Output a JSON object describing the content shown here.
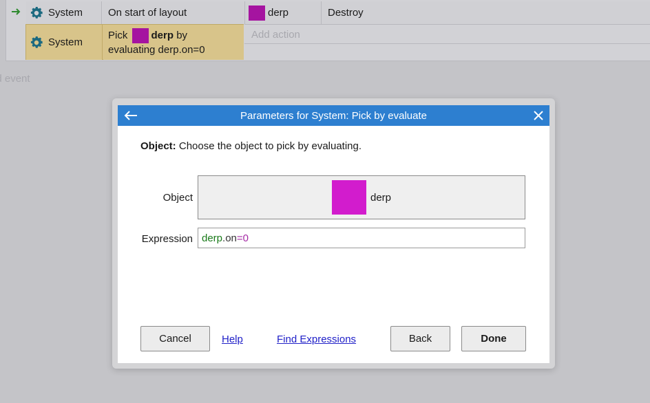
{
  "event_sheet": {
    "event1": {
      "condition_object": "System",
      "condition_text": "On start of layout",
      "action_object": "derp",
      "action_text": "Destroy"
    },
    "event1_sub": {
      "condition_object": "System",
      "pick_prefix": "Pick",
      "pick_object": "derp",
      "pick_suffix": "by",
      "pick_line2": "evaluating derp.on=0"
    },
    "add_action_label": "Add action",
    "add_event_label": "dd event"
  },
  "dialog": {
    "title": "Parameters for System: Pick by evaluate",
    "description_bold": "Object:",
    "description_text": "Choose the object to pick by evaluating.",
    "object_label": "Object",
    "object_value": "derp",
    "expression_label": "Expression",
    "expression": {
      "obj": "derp",
      "dot_prop": ".on",
      "op": "=",
      "num": "0"
    },
    "buttons": {
      "cancel": "Cancel",
      "help": "Help",
      "find_expressions": "Find Expressions",
      "back": "Back",
      "done": "Done"
    }
  },
  "colors": {
    "titlebar": "#2d7fd0",
    "object_swatch": "#d21ccd",
    "sheet_swatch": "#a514a0",
    "selected_row": "#d8c48a"
  },
  "icons": [
    "gear-icon",
    "arrow-right-icon",
    "back-arrow-icon",
    "close-icon"
  ]
}
